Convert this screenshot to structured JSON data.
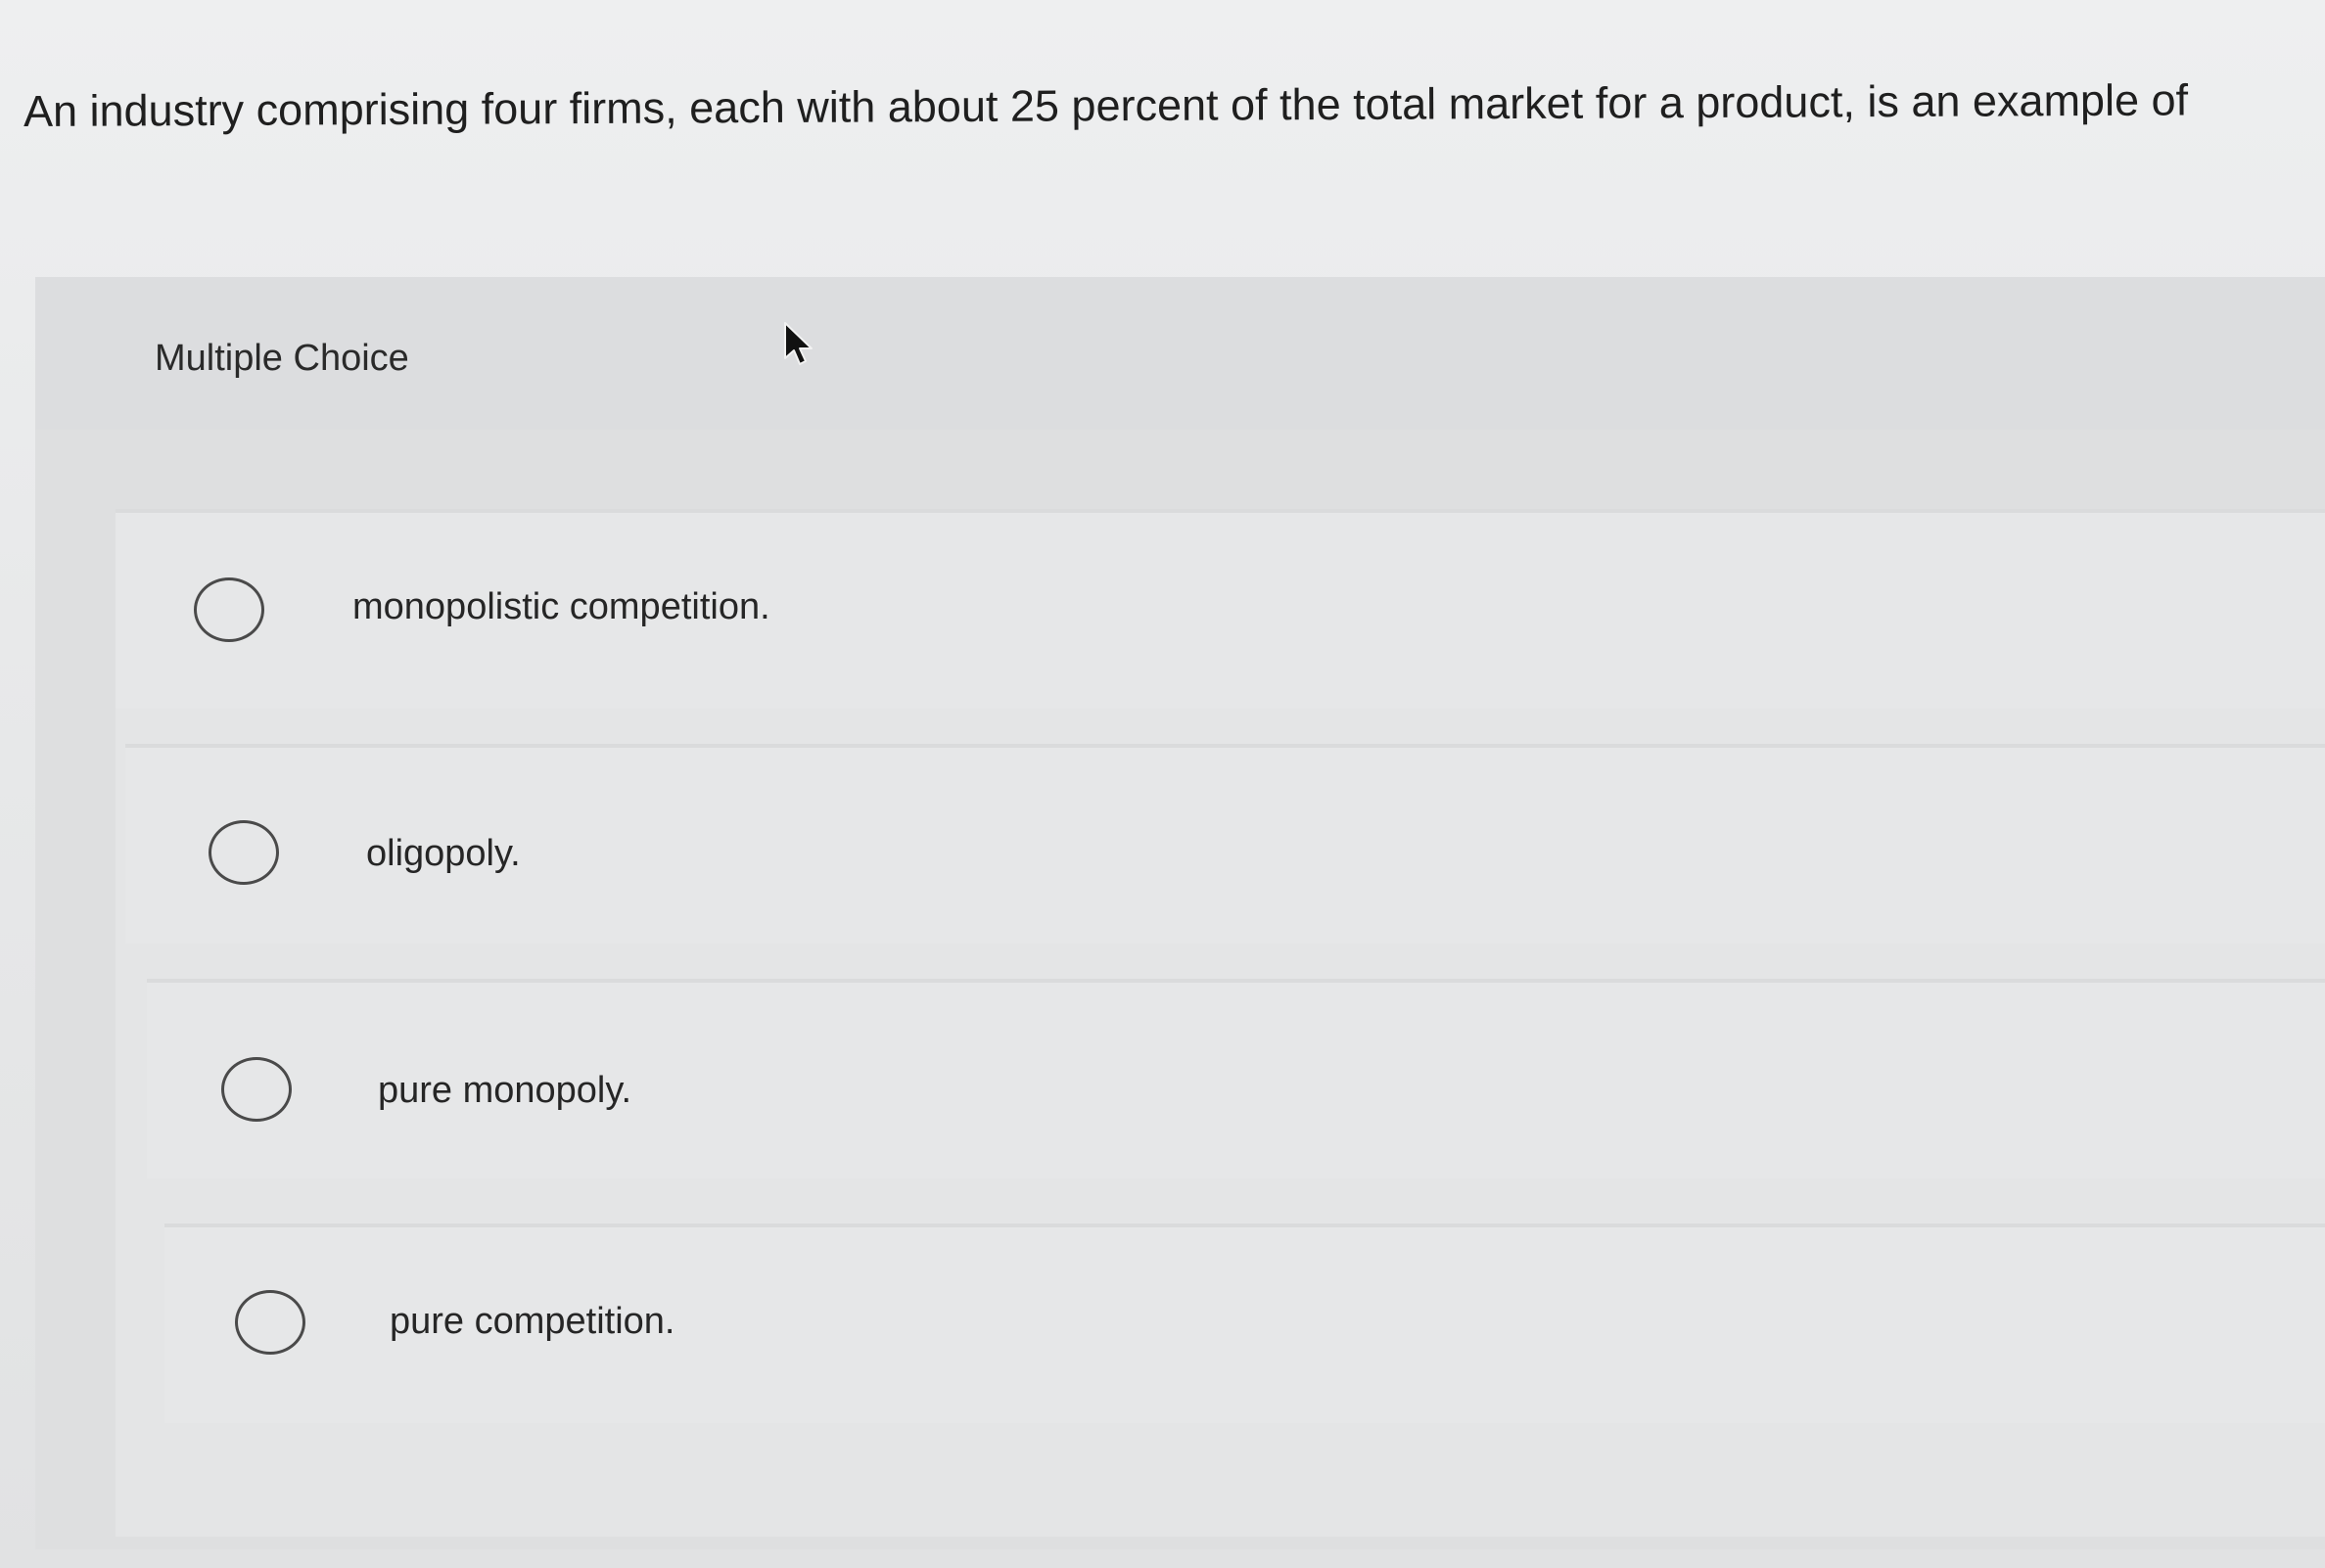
{
  "question": {
    "text": "An industry comprising four firms, each with about 25 percent of the total market for a product, is an example of"
  },
  "section": {
    "label": "Multiple Choice"
  },
  "options": [
    {
      "label": "monopolistic competition.",
      "selected": false
    },
    {
      "label": "oligopoly.",
      "selected": false
    },
    {
      "label": "pure monopoly.",
      "selected": false
    },
    {
      "label": "pure competition.",
      "selected": false
    }
  ],
  "icons": {
    "radio": "radio-empty-icon",
    "cursor": "mouse-pointer-icon"
  }
}
